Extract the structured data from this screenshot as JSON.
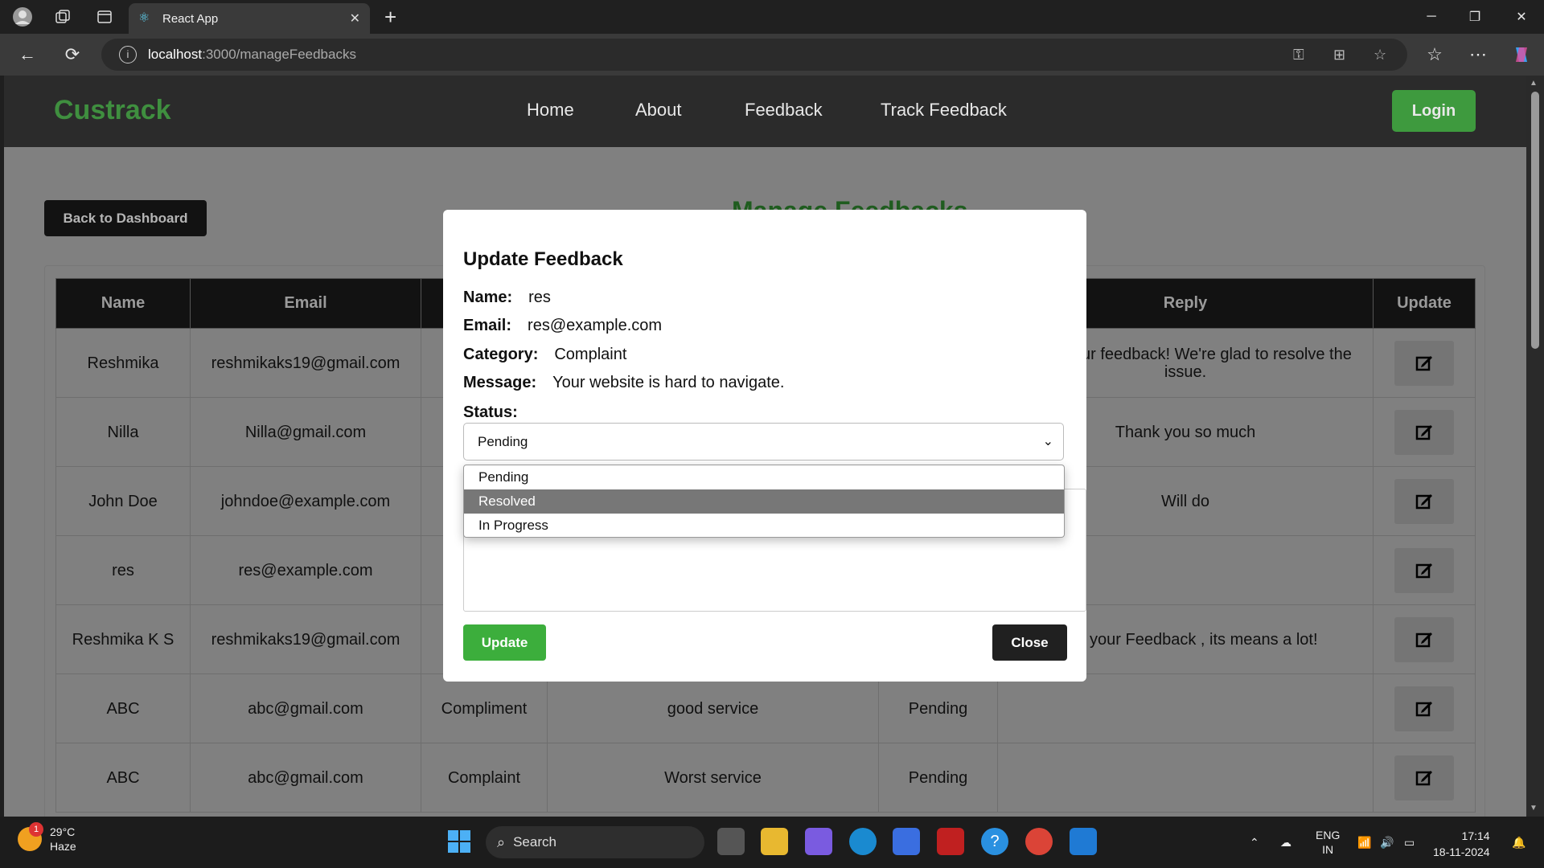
{
  "browser": {
    "tab_title": "React App",
    "url_host": "localhost",
    "url_path": ":3000/manageFeedbacks"
  },
  "navbar": {
    "brand": "Custrack",
    "links": [
      "Home",
      "About",
      "Feedback",
      "Track Feedback"
    ],
    "login_label": "Login"
  },
  "page": {
    "back_label": "Back to Dashboard",
    "title": "Manage Feedbacks"
  },
  "table": {
    "headers": [
      "Name",
      "Email",
      "",
      "",
      "",
      "Reply",
      "Update"
    ],
    "rows": [
      [
        "Reshmika",
        "reshmikaks19@gmail.com",
        "",
        "",
        "",
        "ou for your feedback! We're glad to resolve the issue."
      ],
      [
        "Nilla",
        "Nilla@gmail.com",
        "",
        "",
        "",
        "Thank you so much"
      ],
      [
        "John Doe",
        "johndoe@example.com",
        "",
        "",
        "",
        "Will do"
      ],
      [
        "res",
        "res@example.com",
        "",
        "",
        "",
        ""
      ],
      [
        "Reshmika K S",
        "reshmikaks19@gmail.com",
        "",
        "",
        "",
        "u for your Feedback , its means a lot!"
      ],
      [
        "ABC",
        "abc@gmail.com",
        "Compliment",
        "good service",
        "Pending",
        ""
      ],
      [
        "ABC",
        "abc@gmail.com",
        "Complaint",
        "Worst service",
        "Pending",
        ""
      ]
    ]
  },
  "modal": {
    "title": "Update Feedback",
    "name_label": "Name:",
    "name_value": "res",
    "email_label": "Email:",
    "email_value": "res@example.com",
    "category_label": "Category:",
    "category_value": "Complaint",
    "message_label": "Message:",
    "message_value": "Your website is hard to navigate.",
    "status_label": "Status:",
    "status_selected": "Pending",
    "status_options": [
      "Pending",
      "Resolved",
      "In Progress"
    ],
    "status_highlighted": "Resolved",
    "update_label": "Update",
    "close_label": "Close"
  },
  "taskbar": {
    "weather_temp": "29°C",
    "weather_desc": "Haze",
    "weather_badge": "1",
    "search_label": "Search",
    "lang_top": "ENG",
    "lang_bottom": "IN",
    "time": "17:14",
    "date": "18-11-2024"
  },
  "colors": {
    "brand_green": "#3f8f3f",
    "update_green": "#3cae3c",
    "header_dark": "#121212"
  }
}
